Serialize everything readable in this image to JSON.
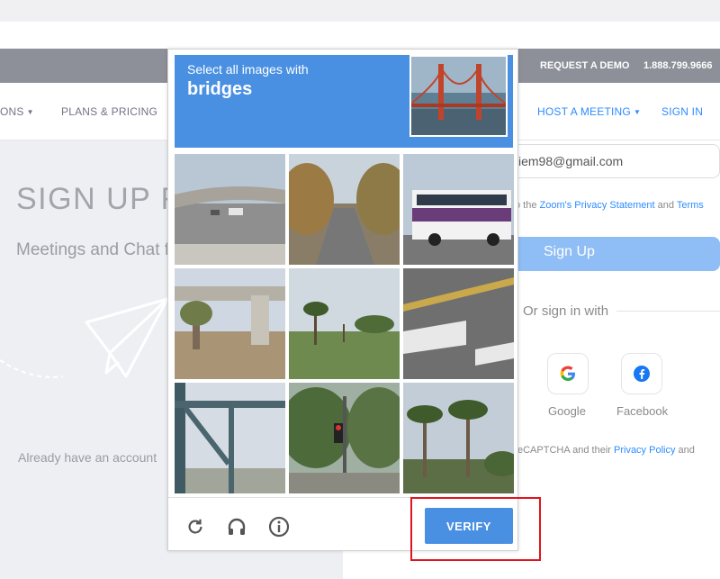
{
  "topbar": {
    "request_demo": "REQUEST A DEMO",
    "phone": "1.888.799.9666"
  },
  "nav": {
    "solutions_partial": "ONS",
    "plans_pricing": "PLANS & PRICING",
    "host_meeting": "HOST A MEETING",
    "sign_in": "SIGN IN"
  },
  "page": {
    "title_partial": "SIGN UP F",
    "subtitle_partial": "Meetings and Chat f",
    "already_partial": "Already have an account"
  },
  "form": {
    "email_value": "iem98@gmail.com",
    "terms_prefix": "o the ",
    "privacy_link": "Zoom's Privacy Statement",
    "terms_and": " and ",
    "terms_link": "Terms",
    "signup_label": "Sign Up",
    "or_sign_in_with": "Or sign in with",
    "google_label": "Google",
    "facebook_label": "Facebook",
    "recaptcha_prefix": "eCAPTCHA and their ",
    "privacy_policy_link": "Privacy Policy",
    "recaptcha_suffix": " and"
  },
  "captcha": {
    "prompt": "Select all images with",
    "target": "bridges",
    "verify_label": "VERIFY",
    "tiles": [
      {
        "name": "tile-overpass-highway"
      },
      {
        "name": "tile-tree-lined-road"
      },
      {
        "name": "tile-bus-street"
      },
      {
        "name": "tile-bridge-pillar"
      },
      {
        "name": "tile-park-palms"
      },
      {
        "name": "tile-road-markings"
      },
      {
        "name": "tile-steel-bridge"
      },
      {
        "name": "tile-traffic-lights"
      },
      {
        "name": "tile-palm-trees"
      }
    ]
  },
  "colors": {
    "captcha_blue": "#4a90e2",
    "zoom_blue": "#2d8cff",
    "highlight_red": "#e0141f"
  }
}
